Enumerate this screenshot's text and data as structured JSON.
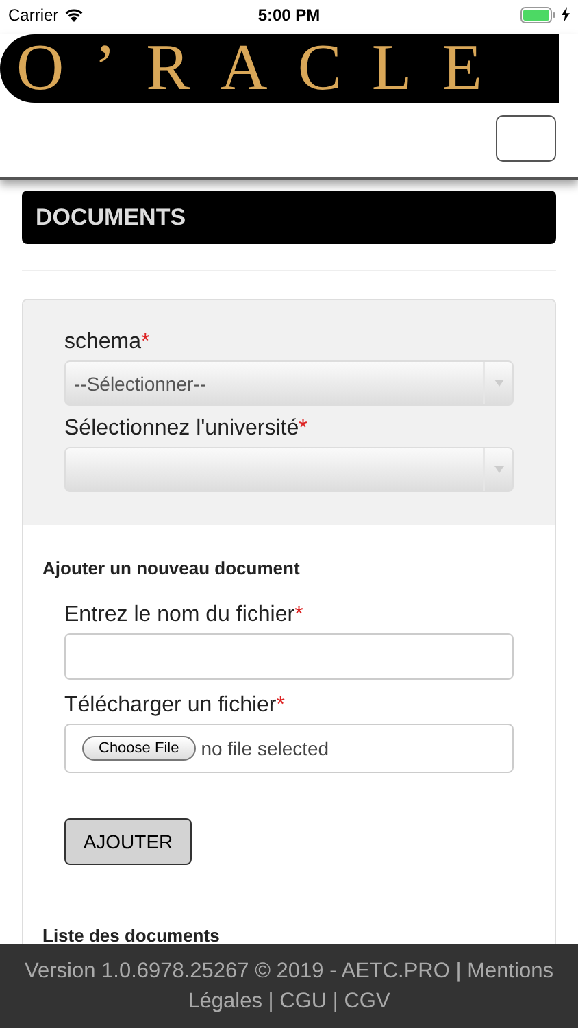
{
  "status_bar": {
    "carrier": "Carrier",
    "time": "5:00 PM"
  },
  "header": {
    "logo": "O’RACLE"
  },
  "page_title": "DOCUMENTS",
  "filters": [
    {
      "label": "schema",
      "required_mark": "*",
      "value": "--Sélectionner--"
    },
    {
      "label": "Sélectionnez l'université",
      "required_mark": "*"
    }
  ],
  "new_document": {
    "heading": "Ajouter un nouveau document",
    "name_field": {
      "label": "Entrez le nom du fichier",
      "required_mark": "*"
    },
    "file_field": {
      "label": "Télécharger un fichier",
      "required_mark": "*",
      "button": "Choose File",
      "status": "no file selected"
    },
    "submit": "AJOUTER"
  },
  "list_heading": "Liste des documents",
  "footer": {
    "text": "Version 1.0.6978.25267 © 2019 - AETC.PRO | Mentions Légales | CGU | CGV"
  }
}
